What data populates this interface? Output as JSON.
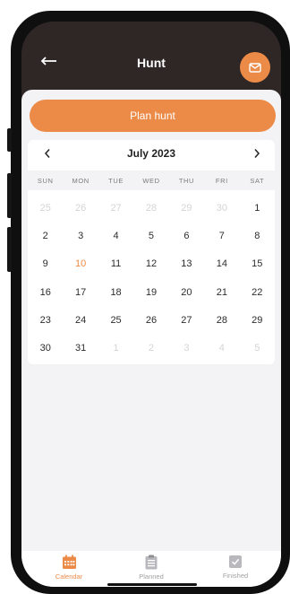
{
  "header": {
    "title": "Hunt"
  },
  "actions": {
    "plan_hunt": "Plan hunt"
  },
  "calendar": {
    "month": "July 2023",
    "weekdays": [
      "SUN",
      "MON",
      "TUE",
      "WED",
      "THU",
      "FRI",
      "SAT"
    ],
    "days": [
      {
        "d": "25",
        "s": "muted"
      },
      {
        "d": "26",
        "s": "muted"
      },
      {
        "d": "27",
        "s": "muted"
      },
      {
        "d": "28",
        "s": "muted"
      },
      {
        "d": "29",
        "s": "muted"
      },
      {
        "d": "30",
        "s": "muted"
      },
      {
        "d": "1",
        "s": "normal"
      },
      {
        "d": "2",
        "s": "normal"
      },
      {
        "d": "3",
        "s": "normal"
      },
      {
        "d": "4",
        "s": "normal"
      },
      {
        "d": "5",
        "s": "normal"
      },
      {
        "d": "6",
        "s": "normal"
      },
      {
        "d": "7",
        "s": "normal"
      },
      {
        "d": "8",
        "s": "normal"
      },
      {
        "d": "9",
        "s": "normal"
      },
      {
        "d": "10",
        "s": "today"
      },
      {
        "d": "11",
        "s": "normal"
      },
      {
        "d": "12",
        "s": "normal"
      },
      {
        "d": "13",
        "s": "normal"
      },
      {
        "d": "14",
        "s": "normal"
      },
      {
        "d": "15",
        "s": "normal"
      },
      {
        "d": "16",
        "s": "normal"
      },
      {
        "d": "17",
        "s": "normal"
      },
      {
        "d": "18",
        "s": "normal"
      },
      {
        "d": "19",
        "s": "normal"
      },
      {
        "d": "20",
        "s": "normal"
      },
      {
        "d": "21",
        "s": "normal"
      },
      {
        "d": "22",
        "s": "normal"
      },
      {
        "d": "23",
        "s": "normal"
      },
      {
        "d": "24",
        "s": "normal"
      },
      {
        "d": "25",
        "s": "normal"
      },
      {
        "d": "26",
        "s": "normal"
      },
      {
        "d": "27",
        "s": "normal"
      },
      {
        "d": "28",
        "s": "normal"
      },
      {
        "d": "29",
        "s": "normal"
      },
      {
        "d": "30",
        "s": "normal"
      },
      {
        "d": "31",
        "s": "normal"
      },
      {
        "d": "1",
        "s": "muted"
      },
      {
        "d": "2",
        "s": "muted"
      },
      {
        "d": "3",
        "s": "muted"
      },
      {
        "d": "4",
        "s": "muted"
      },
      {
        "d": "5",
        "s": "muted"
      }
    ]
  },
  "tabs": [
    {
      "label": "Calendar",
      "icon": "calendar-icon",
      "active": true
    },
    {
      "label": "Planned",
      "icon": "clipboard-icon",
      "active": false
    },
    {
      "label": "Finished",
      "icon": "checkbox-icon",
      "active": false
    }
  ],
  "colors": {
    "accent": "#ec8b48",
    "header_bg": "#2e2725",
    "content_bg": "#f3f3f5",
    "muted_text": "#d4d4d7"
  }
}
